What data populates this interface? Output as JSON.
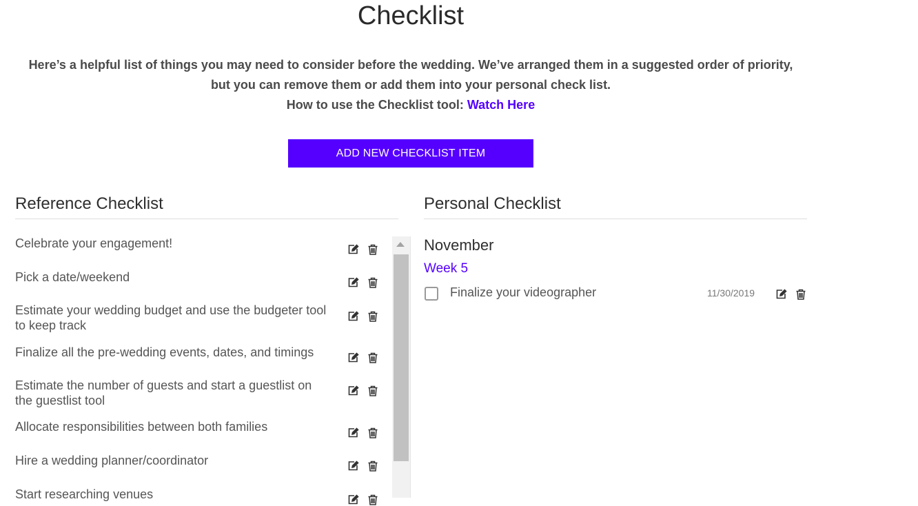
{
  "page": {
    "title": "Checklist",
    "intro_line1": "Here’s a helpful list of things you may need to consider before the wedding. We’ve arranged them in a suggested order of priority, but you can remove them or add them into your personal check list.",
    "howto_label": "How to use the Checklist tool:",
    "howto_link": "Watch Here",
    "add_button": "ADD NEW CHECKLIST ITEM"
  },
  "reference": {
    "title": "Reference Checklist",
    "items": [
      {
        "label": "Celebrate your engagement!"
      },
      {
        "label": "Pick a date/weekend"
      },
      {
        "label": "Estimate your wedding budget and use the budgeter tool to keep track"
      },
      {
        "label": "Finalize all the pre-wedding events, dates, and timings"
      },
      {
        "label": "Estimate the number of guests and start a guestlist on the guestlist tool"
      },
      {
        "label": "Allocate responsibilities between both families"
      },
      {
        "label": "Hire a wedding planner/coordinator"
      },
      {
        "label": "Start researching venues"
      }
    ]
  },
  "personal": {
    "title": "Personal Checklist",
    "month": "November",
    "week": "Week 5",
    "items": [
      {
        "label": "Finalize your videographer",
        "date": "11/30/2019",
        "checked": false
      }
    ]
  },
  "colors": {
    "accent": "#5500ff"
  },
  "icons": [
    "edit-icon",
    "trash-icon"
  ]
}
